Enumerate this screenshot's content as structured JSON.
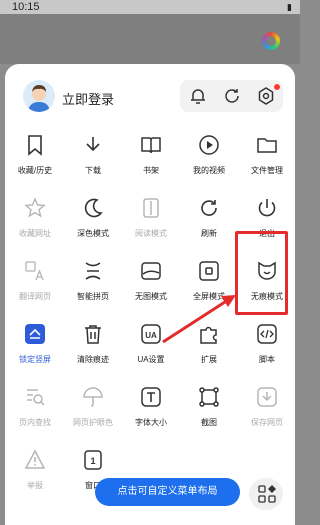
{
  "status": {
    "time": "10:15"
  },
  "header": {
    "login_label": "立即登录"
  },
  "menu": {
    "rows": [
      [
        {
          "label": "收藏/历史",
          "icon": "bookmark-icon",
          "state": "on"
        },
        {
          "label": "下载",
          "icon": "download-icon",
          "state": "on"
        },
        {
          "label": "书架",
          "icon": "book-icon",
          "state": "on"
        },
        {
          "label": "我的视频",
          "icon": "play-icon",
          "state": "on"
        },
        {
          "label": "文件管理",
          "icon": "folder-icon",
          "state": "on"
        }
      ],
      [
        {
          "label": "收藏网址",
          "icon": "star-icon",
          "state": "off"
        },
        {
          "label": "深色模式",
          "icon": "moon-icon",
          "state": "on"
        },
        {
          "label": "阅读模式",
          "icon": "reader-icon",
          "state": "off"
        },
        {
          "label": "刷新",
          "icon": "refresh-icon",
          "state": "on"
        },
        {
          "label": "退出",
          "icon": "power-icon",
          "state": "on"
        }
      ],
      [
        {
          "label": "翻译网页",
          "icon": "translate-icon",
          "state": "off"
        },
        {
          "label": "智能拼页",
          "icon": "merge-page-icon",
          "state": "on"
        },
        {
          "label": "无图模式",
          "icon": "no-image-icon",
          "state": "on"
        },
        {
          "label": "全屏模式",
          "icon": "fullscreen-icon",
          "state": "on"
        },
        {
          "label": "无痕模式",
          "icon": "incognito-icon",
          "state": "on"
        }
      ],
      [
        {
          "label": "锁定竖屏",
          "icon": "lock-portrait-icon",
          "state": "active"
        },
        {
          "label": "清除痕迹",
          "icon": "trash-icon",
          "state": "on"
        },
        {
          "label": "UA设置",
          "icon": "ua-icon",
          "state": "on"
        },
        {
          "label": "扩展",
          "icon": "puzzle-icon",
          "state": "on"
        },
        {
          "label": "脚本",
          "icon": "script-icon",
          "state": "on"
        }
      ],
      [
        {
          "label": "页内查找",
          "icon": "find-in-page-icon",
          "state": "off"
        },
        {
          "label": "网页护眼色",
          "icon": "umbrella-icon",
          "state": "off"
        },
        {
          "label": "字体大小",
          "icon": "font-size-icon",
          "state": "on"
        },
        {
          "label": "截图",
          "icon": "screenshot-icon",
          "state": "on"
        },
        {
          "label": "保存网页",
          "icon": "save-page-icon",
          "state": "off"
        }
      ],
      [
        {
          "label": "举报",
          "icon": "report-icon",
          "state": "off"
        },
        {
          "label": "窗口",
          "icon": "window-icon",
          "state": "on"
        }
      ]
    ]
  },
  "footer": {
    "customize_label": "点击可自定义菜单布局"
  }
}
